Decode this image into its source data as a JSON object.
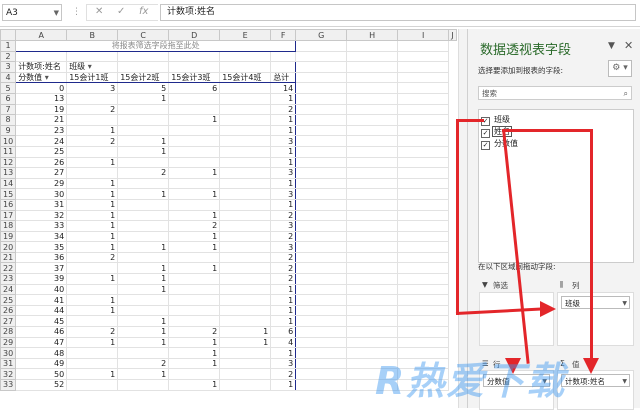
{
  "formula_bar": {
    "name_box": "A3",
    "cancel": "✕",
    "enter": "✓",
    "fx": "fx",
    "formula": "计数项:姓名"
  },
  "columns": [
    "A",
    "B",
    "C",
    "D",
    "E",
    "F",
    "G",
    "H",
    "I",
    "J"
  ],
  "sheet": {
    "filter_hint": "将报表筛选字段拖至此处",
    "value_label": "计数项:姓名",
    "col_field": "班级",
    "row_field": "分数值",
    "col_headers": [
      "15会计1班",
      "15会计2班",
      "15会计3班",
      "15会计4班",
      "总计"
    ],
    "rows": [
      {
        "r": "5",
        "v": [
          "0",
          "3",
          "5",
          "6",
          "",
          "14"
        ]
      },
      {
        "r": "6",
        "v": [
          "13",
          "",
          "1",
          "",
          "",
          "1"
        ]
      },
      {
        "r": "7",
        "v": [
          "19",
          "2",
          "",
          "",
          "",
          "2"
        ]
      },
      {
        "r": "8",
        "v": [
          "21",
          "",
          "",
          "1",
          "",
          "1"
        ]
      },
      {
        "r": "9",
        "v": [
          "23",
          "1",
          "",
          "",
          "",
          "1"
        ]
      },
      {
        "r": "10",
        "v": [
          "24",
          "2",
          "1",
          "",
          "",
          "3"
        ]
      },
      {
        "r": "11",
        "v": [
          "25",
          "",
          "1",
          "",
          "",
          "1"
        ]
      },
      {
        "r": "12",
        "v": [
          "26",
          "1",
          "",
          "",
          "",
          "1"
        ]
      },
      {
        "r": "13",
        "v": [
          "27",
          "",
          "2",
          "1",
          "",
          "3"
        ]
      },
      {
        "r": "14",
        "v": [
          "29",
          "1",
          "",
          "",
          "",
          "1"
        ]
      },
      {
        "r": "15",
        "v": [
          "30",
          "1",
          "1",
          "1",
          "",
          "3"
        ]
      },
      {
        "r": "16",
        "v": [
          "31",
          "1",
          "",
          "",
          "",
          "1"
        ]
      },
      {
        "r": "17",
        "v": [
          "32",
          "1",
          "",
          "1",
          "",
          "2"
        ]
      },
      {
        "r": "18",
        "v": [
          "33",
          "1",
          "",
          "2",
          "",
          "3"
        ]
      },
      {
        "r": "19",
        "v": [
          "34",
          "1",
          "",
          "1",
          "",
          "2"
        ]
      },
      {
        "r": "20",
        "v": [
          "35",
          "1",
          "1",
          "1",
          "",
          "3"
        ]
      },
      {
        "r": "21",
        "v": [
          "36",
          "2",
          "",
          "",
          "",
          "2"
        ]
      },
      {
        "r": "22",
        "v": [
          "37",
          "",
          "1",
          "1",
          "",
          "2"
        ]
      },
      {
        "r": "23",
        "v": [
          "39",
          "1",
          "1",
          "",
          "",
          "2"
        ]
      },
      {
        "r": "24",
        "v": [
          "40",
          "",
          "1",
          "",
          "",
          "1"
        ]
      },
      {
        "r": "25",
        "v": [
          "41",
          "1",
          "",
          "",
          "",
          "1"
        ]
      },
      {
        "r": "26",
        "v": [
          "44",
          "1",
          "",
          "",
          "",
          "1"
        ]
      },
      {
        "r": "27",
        "v": [
          "45",
          "",
          "1",
          "",
          "",
          "1"
        ]
      },
      {
        "r": "28",
        "v": [
          "46",
          "2",
          "1",
          "2",
          "1",
          "6"
        ]
      },
      {
        "r": "29",
        "v": [
          "47",
          "1",
          "1",
          "1",
          "1",
          "4"
        ]
      },
      {
        "r": "30",
        "v": [
          "48",
          "",
          "",
          "1",
          "",
          "1"
        ]
      },
      {
        "r": "31",
        "v": [
          "49",
          "",
          "2",
          "1",
          "",
          "3"
        ]
      },
      {
        "r": "32",
        "v": [
          "50",
          "1",
          "1",
          "",
          "",
          "2"
        ]
      },
      {
        "r": "33",
        "v": [
          "52",
          "",
          "",
          "1",
          "",
          "1"
        ]
      }
    ]
  },
  "pane": {
    "title": "数据透视表字段",
    "subtitle": "选择要添加到报表的字段:",
    "search_placeholder": "搜索",
    "fields": [
      {
        "label": "班级",
        "checked": true
      },
      {
        "label": "姓名",
        "checked": true
      },
      {
        "label": "分数值",
        "checked": true
      }
    ],
    "drag_hint": "在以下区域间拖动字段:",
    "filters_label": "筛选",
    "columns_label": "列",
    "rows_label": "行",
    "values_label": "值",
    "columns_chip": "班级",
    "rows_chip": "分数值",
    "values_chip": "计数项:姓名",
    "sigma": "Σ"
  },
  "watermark": "R热爱下载",
  "colors": {
    "pivot_border": "#1f2a8c",
    "arrow": "#e3262a",
    "pane_title": "#2a6a2a"
  }
}
